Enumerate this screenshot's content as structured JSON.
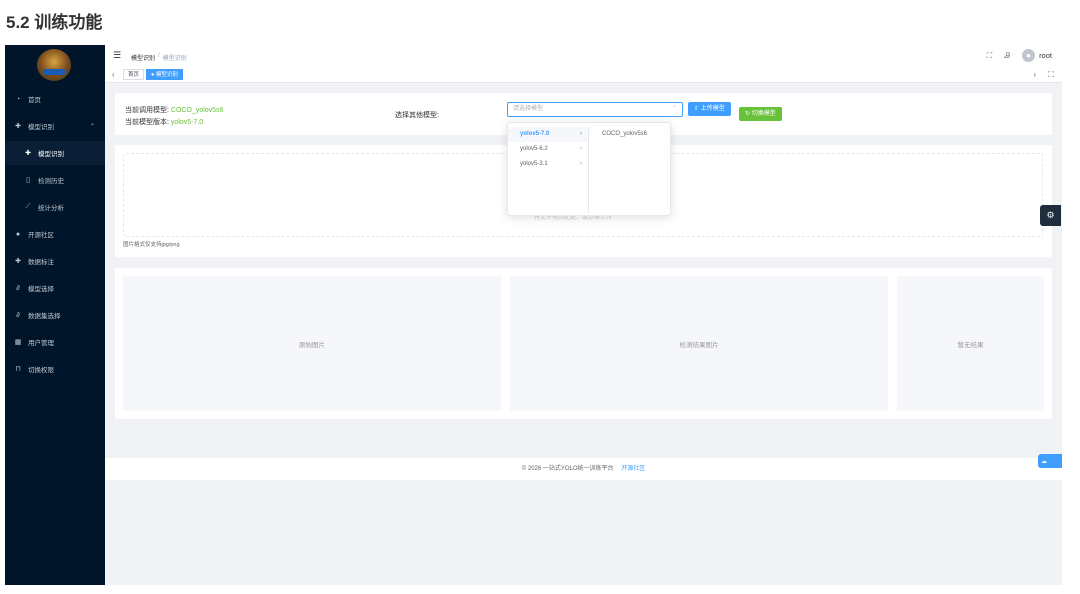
{
  "doc_heading": "5.2 训练功能",
  "sidebar": {
    "items": [
      {
        "label": "首页",
        "icon": "dashboard-icon"
      },
      {
        "label": "模型识别",
        "icon": "plus-circle-icon"
      },
      {
        "label": "模型识别",
        "icon": "plus-circle-icon"
      },
      {
        "label": "检测历史",
        "icon": "document-icon"
      },
      {
        "label": "统计分析",
        "icon": "chart-icon"
      },
      {
        "label": "开源社区",
        "icon": "user-icon"
      },
      {
        "label": "数据标注",
        "icon": "plus-circle-icon"
      },
      {
        "label": "模型选择",
        "icon": "link-icon"
      },
      {
        "label": "数据集选择",
        "icon": "link-icon"
      },
      {
        "label": "用户管理",
        "icon": "grid-icon"
      },
      {
        "label": "切换权限",
        "icon": "lock-icon"
      }
    ]
  },
  "topbar": {
    "breadcrumb": [
      "模型识别",
      "模型识别"
    ],
    "username": "root"
  },
  "tags": {
    "home": "首页",
    "current": "● 模型识别"
  },
  "model_card": {
    "current_model_label": "当前调用模型:",
    "current_model_value": "COCO_yolov5s6",
    "current_version_label": "当前模型版本:",
    "current_version_value": "yolov5-7.0",
    "select_label": "选择其他模型:",
    "select_placeholder": "请选择模型",
    "upload_button": "上传模型",
    "switch_button": "切换模型"
  },
  "upload": {
    "drop_text": "将文件拖到此处，或点击上传",
    "hint": "图片格式仅支持jpg/png"
  },
  "panels": {
    "original": "原始图片",
    "result": "检测结果图片",
    "no_result": "暂无结果"
  },
  "footer": {
    "text": "© 2026 一站式YOLO统一训练平台",
    "link": "开源社区"
  },
  "dropdown": {
    "versions": [
      "yolov5-7.0",
      "yolov5-6.2",
      "yolov5-3.1"
    ],
    "models": [
      "COCO_yolov5s6"
    ]
  },
  "colors": {
    "sidebar_bg": "#001529",
    "primary": "#409eff",
    "success": "#67c23a"
  }
}
